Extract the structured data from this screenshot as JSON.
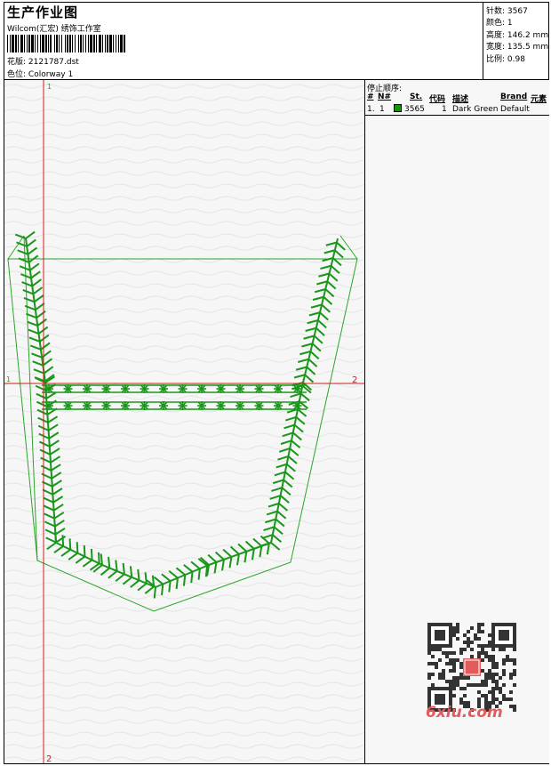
{
  "header": {
    "title": "生产作业图",
    "company": "Wilcom(汇宏) 绣饰工作室",
    "design_label": "花版:",
    "design_value": "2121787.dst",
    "color_label": "色位:",
    "color_value": "Colorway 1"
  },
  "stats": [
    {
      "label": "针数:",
      "value": "3567"
    },
    {
      "label": "颜色:",
      "value": "1"
    },
    {
      "label": "高度:",
      "value": "146.2 mm"
    },
    {
      "label": "宽度:",
      "value": "135.5 mm"
    },
    {
      "label": "比例:",
      "value": "0.98"
    }
  ],
  "stop_sequence": {
    "title": "停止顺序:",
    "columns": [
      "#",
      "N#",
      "St.",
      "代码",
      "描述",
      "Brand",
      "元素"
    ],
    "rows": [
      {
        "num": "1.",
        "needle": "1",
        "stitches": "3565",
        "code": "1",
        "description": "Dark Green",
        "brand": "Default",
        "color": "#1a8f1a"
      }
    ]
  },
  "axes": {
    "x_start": "1",
    "x_end": "2",
    "y_start": "1",
    "y_end": "2",
    "color": "#d11d1d"
  },
  "embroidery": {
    "thread_color": "#1a961a",
    "outline_color": "#29a329"
  },
  "watermark": {
    "site": "6xiu.com",
    "seal_chars": "汉博图库"
  }
}
